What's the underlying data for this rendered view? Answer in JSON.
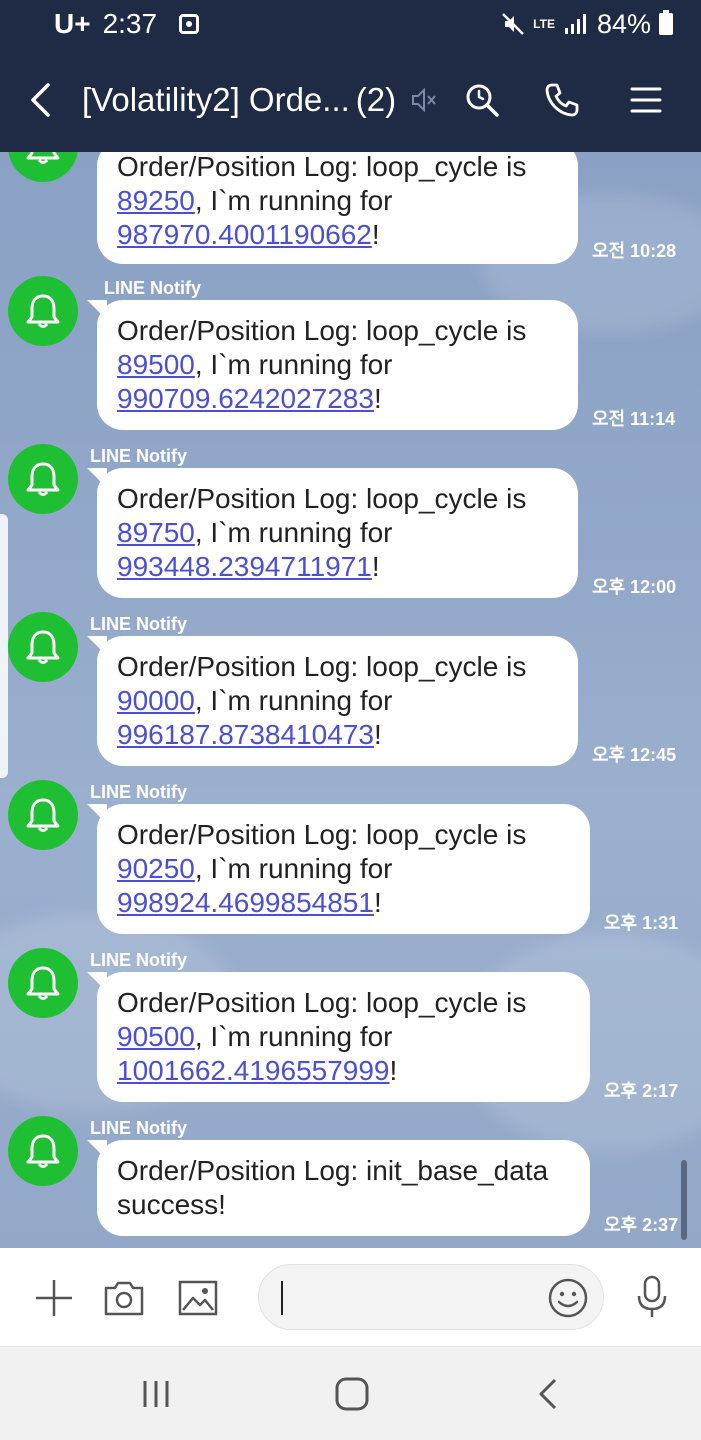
{
  "status_bar": {
    "carrier": "U+",
    "time": "2:37",
    "battery": "84%",
    "network": "LTE"
  },
  "header": {
    "title": "[Volatility2] Orde...",
    "member_count": "(2)"
  },
  "messages": [
    {
      "sender": "",
      "line1": "Order/Position Log: loop_cycle is",
      "cycle": "89250",
      "mid": ", I`m running for",
      "seconds": "987970.4001190662",
      "end": "!",
      "time": "오전 10:28"
    },
    {
      "sender": "LINE Notify",
      "line1": "Order/Position Log: loop_cycle is",
      "cycle": "89500",
      "mid": ", I`m running for",
      "seconds": "990709.6242027283",
      "end": "!",
      "time": "오전 11:14"
    },
    {
      "sender": "LINE Notify",
      "line1": "Order/Position Log: loop_cycle is",
      "cycle": "89750",
      "mid": ", I`m running for",
      "seconds": "993448.2394711971",
      "end": "!",
      "time": "오후 12:00"
    },
    {
      "sender": "LINE Notify",
      "line1": "Order/Position Log: loop_cycle is",
      "cycle": "90000",
      "mid": ", I`m running for",
      "seconds": "996187.8738410473",
      "end": "!",
      "time": "오후 12:45"
    },
    {
      "sender": "LINE Notify",
      "line1": "Order/Position Log: loop_cycle is",
      "cycle": "90250",
      "mid": ", I`m running for",
      "seconds": "998924.4699854851",
      "end": "!",
      "time": "오후 1:31"
    },
    {
      "sender": "LINE Notify",
      "line1": "Order/Position Log: loop_cycle is",
      "cycle": "90500",
      "mid": ", I`m running for",
      "seconds": "1001662.4196557999",
      "end": "!",
      "time": "오후 2:17"
    },
    {
      "sender": "LINE Notify",
      "line1": "Order/Position Log: init_base_data",
      "line2": "success!",
      "time": "오후 2:37"
    }
  ],
  "colors": {
    "header_bg": "#1f2b45",
    "avatar_green": "#1fbf33",
    "link": "#4a4fd6"
  },
  "icons": {
    "back": "chevron-left-icon",
    "mute": "mute-icon",
    "search": "search-icon",
    "call": "phone-icon",
    "menu": "hamburger-menu-icon",
    "add": "plus-icon",
    "camera": "camera-icon",
    "gallery": "image-icon",
    "emoji": "emoji-icon",
    "mic": "microphone-icon"
  }
}
